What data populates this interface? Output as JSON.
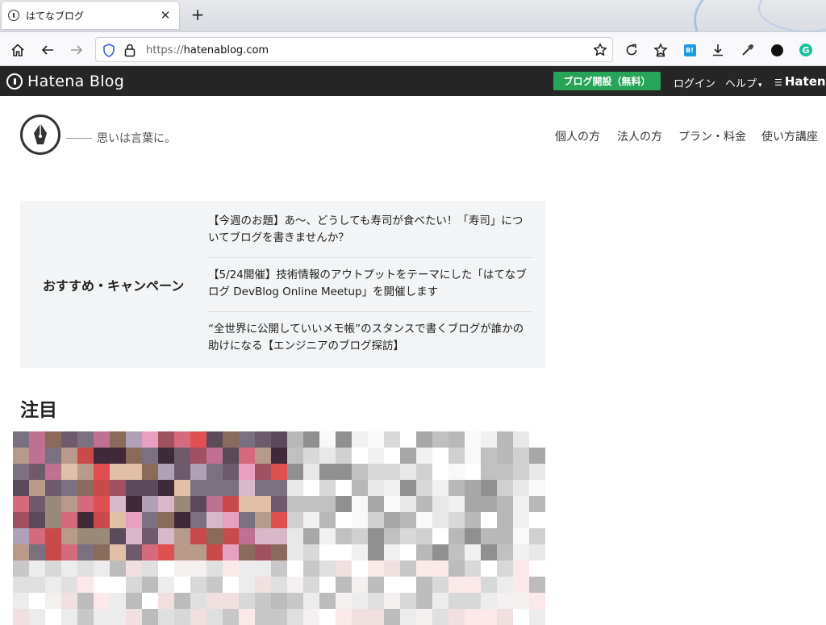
{
  "browser": {
    "tab_title": "はてなブログ",
    "tab_close": "✕",
    "new_tab": "+",
    "url_protocol": "https://",
    "url_host": "hatenablog.com"
  },
  "site_bar": {
    "logo_text": "Hatena Blog",
    "open_blog_button": "ブログ開設（無料）",
    "login": "ログイン",
    "help": "ヘルプ",
    "hatena": "Hatena"
  },
  "header": {
    "tagline": "思いは言葉に。",
    "nav": [
      "個人の方",
      "法人の方",
      "プラン・料金",
      "使い方講座"
    ]
  },
  "campaign": {
    "heading": "おすすめ・キャンペーン",
    "items": [
      "【今週のお題】あ〜、どうしても寿司が食べたい！「寿司」についてブログを書きませんか？",
      "【5/24開催】技術情報のアウトプットをテーマにした「はてなブログ DevBlog Online Meetup」を開催します",
      "“全世界に公開していいメモ帳”のスタンスで書くブログが誰かの助けになる【エンジニアのブログ探訪】"
    ]
  },
  "featured": {
    "title": "注目"
  },
  "colors": {
    "site_bar": "#262626",
    "open_button": "#26a457",
    "campaign_bg": "#f3f4f5"
  }
}
